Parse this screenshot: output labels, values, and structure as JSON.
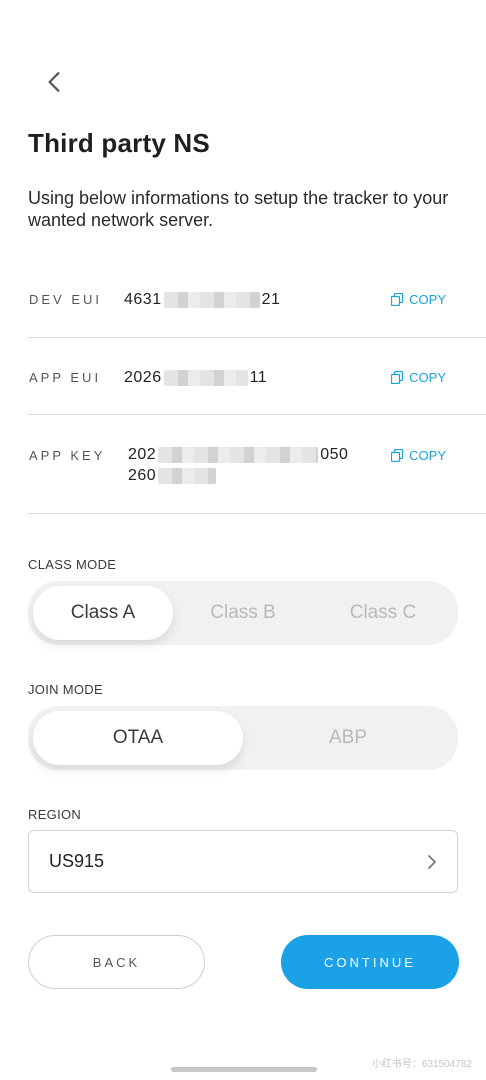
{
  "header": {
    "back_icon": "chevron-left-icon",
    "title": "Third party NS",
    "description": "Using below informations to setup the tracker to your wanted network server."
  },
  "credentials": [
    {
      "label": "DEV EUI",
      "value_start": "4631",
      "value_end": "21",
      "copy_label": "COPY"
    },
    {
      "label": "APP EUI",
      "value_start": "2026",
      "value_end": "11",
      "copy_label": "COPY"
    },
    {
      "label": "APP KEY",
      "line1_start": "202",
      "line1_end": "050",
      "line2_start": "260",
      "copy_label": "COPY"
    }
  ],
  "class_mode": {
    "label": "CLASS MODE",
    "options": [
      "Class A",
      "Class B",
      "Class C"
    ],
    "selected": "Class A"
  },
  "join_mode": {
    "label": "JOIN MODE",
    "options": [
      "OTAA",
      "ABP"
    ],
    "selected": "OTAA"
  },
  "region": {
    "label": "REGION",
    "value": "US915"
  },
  "actions": {
    "back_label": "BACK",
    "continue_label": "CONTINUE"
  },
  "watermark": "小红书号：631504782",
  "colors": {
    "accent": "#1aa1e6",
    "copy": "#1aa3d9",
    "segment_bg": "#f1f1f1"
  }
}
